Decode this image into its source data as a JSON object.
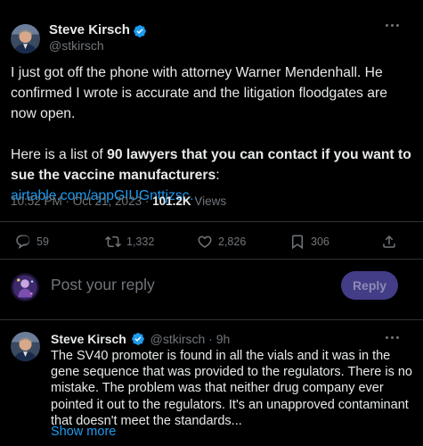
{
  "post": {
    "author_name": "Steve Kirsch",
    "author_handle": "@stkirsch",
    "paragraph1": "I just got off the phone with attorney Warner Mendenhall. He confirmed I wrote is accurate and the litigation floodgates are now open.",
    "paragraph2_plain": "Here is a list of ",
    "paragraph2_bold": "90 lawyers that you can contact if you want to sue the vaccine manufacturers",
    "paragraph2_sep": ": ",
    "link_text": "airtable.com/appGIUGnttjzsc…",
    "timestamp": "10:52 PM · Oct 21, 2023 · ",
    "view_count": "101.2K",
    "views_label": " Views"
  },
  "actions": {
    "replies": "59",
    "reposts": "1,332",
    "likes": "2,826",
    "bookmarks": "306"
  },
  "composer": {
    "placeholder": "Post your reply",
    "reply_button": "Reply"
  },
  "reply": {
    "author_name": "Steve Kirsch",
    "author_handle": "@stkirsch",
    "sep": " · ",
    "time": "9h",
    "text": "The SV40 promoter is found in all the vials and it was in the gene sequence that was provided to the regulators. There is no mistake. The problem was that neither drug company ever pointed it out to the regulators. It's an unapproved contaminant that doesn't meet the standards...",
    "show_more": "Show more"
  },
  "colors": {
    "background": "#000000",
    "text": "#e7e9ea",
    "muted": "#71767b",
    "link": "#1d9bf0",
    "verified": "#1d9bf0",
    "reply_button_bg": "#423d86",
    "divider": "#2f3336"
  },
  "icons": [
    "verified-badge-icon",
    "more-icon",
    "reply-icon",
    "repost-icon",
    "like-icon",
    "bookmark-icon",
    "share-icon"
  ]
}
